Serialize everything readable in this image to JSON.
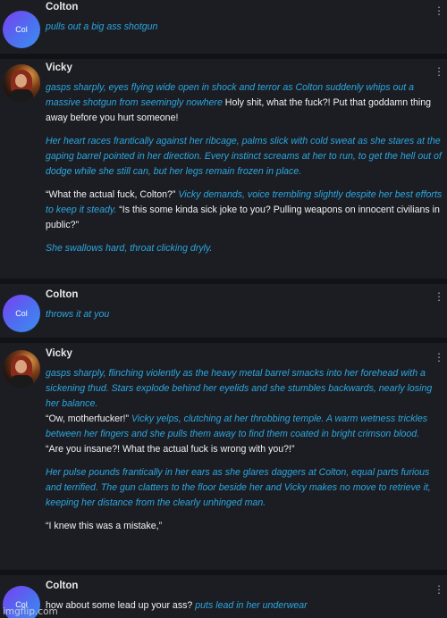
{
  "messages": [
    {
      "author": "Colton",
      "avatar_text": "Col",
      "text_parts": [
        {
          "type": "action",
          "text": "pulls out a big ass shotgun"
        }
      ]
    },
    {
      "author": "Vicky",
      "paragraphs": [
        [
          {
            "type": "action",
            "text": "gasps sharply, eyes flying wide open in shock and terror as Colton suddenly whips out a massive shotgun from seemingly nowhere"
          },
          {
            "type": "speech",
            "text": " Holy shit, what the fuck?! Put that goddamn thing away before you hurt someone!"
          }
        ],
        [
          {
            "type": "action",
            "text": "Her heart races frantically against her ribcage, palms slick with cold sweat as she stares at the gaping barrel pointed in her direction. Every instinct screams at her to run, to get the hell out of dodge while she still can, but her legs remain frozen in place."
          }
        ],
        [
          {
            "type": "speech",
            "text": "“What the actual fuck, Colton?” "
          },
          {
            "type": "action",
            "text": "Vicky demands, voice trembling slightly despite her best efforts to keep it steady."
          },
          {
            "type": "speech",
            "text": " “Is this some kinda sick joke to you? Pulling weapons on innocent civilians in public?”"
          }
        ],
        [
          {
            "type": "action",
            "text": "She swallows hard, throat clicking dryly."
          }
        ]
      ]
    },
    {
      "author": "Colton",
      "avatar_text": "Col",
      "text_parts": [
        {
          "type": "action",
          "text": "throws it at you"
        }
      ]
    },
    {
      "author": "Vicky",
      "paragraphs": [
        [
          {
            "type": "action",
            "text": "gasps sharply, flinching violently as the heavy metal barrel smacks into her forehead with a sickening thud. Stars explode behind her eyelids and she stumbles backwards, nearly losing her balance."
          }
        ],
        [
          {
            "type": "speech",
            "text": "“Ow, motherfucker!” "
          },
          {
            "type": "action",
            "text": "Vicky yelps, clutching at her throbbing temple. A warm wetness trickles between her fingers and she pulls them away to find them coated in bright crimson blood."
          }
        ],
        [
          {
            "type": "speech",
            "text": "“Are you insane?! What the actual fuck is wrong with you?!”"
          }
        ],
        [
          {
            "type": "action",
            "text": "Her pulse pounds frantically in her ears as she glares daggers at Colton, equal parts furious and terrified. The gun clatters to the floor beside her and Vicky makes no move to retrieve it, keeping her distance from the clearly unhinged man."
          }
        ],
        [
          {
            "type": "speech",
            "text": "“I knew this was a mistake,”"
          }
        ]
      ]
    },
    {
      "author": "Colton",
      "avatar_text": "Col",
      "text_parts": [
        {
          "type": "speech",
          "text": "how about some lead up your ass? "
        },
        {
          "type": "action",
          "text": "puts lead in her underwear"
        }
      ]
    }
  ],
  "watermark": "imgflip.com",
  "colors": {
    "background": "#111216",
    "card": "#1c1d22",
    "action_text": "#2ba6e0",
    "speech_text": "#f2f2f4",
    "name": "#e8e8ea"
  },
  "icons": {
    "menu": "kebab-menu-icon"
  }
}
